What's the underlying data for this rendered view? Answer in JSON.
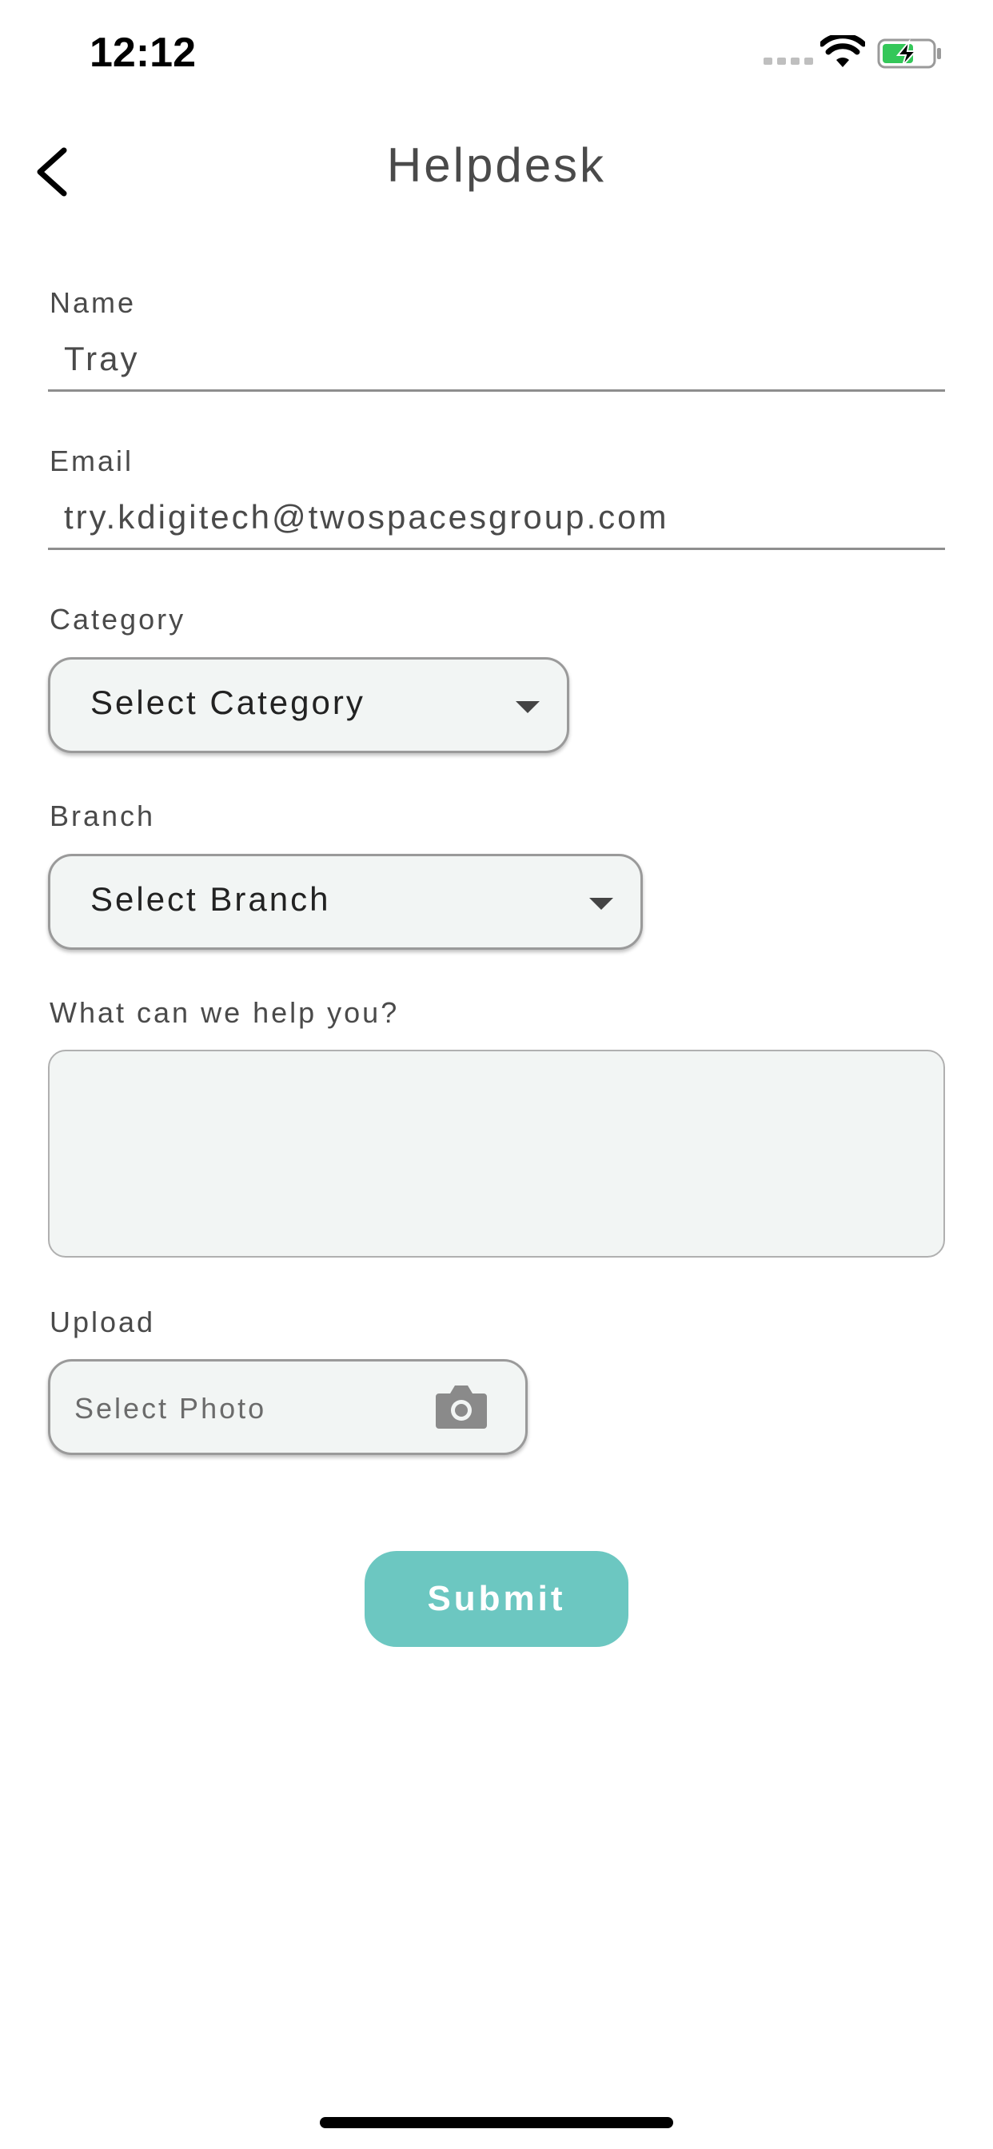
{
  "status_bar": {
    "time": "12:12"
  },
  "header": {
    "title": "Helpdesk"
  },
  "form": {
    "name": {
      "label": "Name",
      "value": "Tray"
    },
    "email": {
      "label": "Email",
      "value": "try.kdigitech@twospacesgroup.com"
    },
    "category": {
      "label": "Category",
      "selected": "Select Category"
    },
    "branch": {
      "label": "Branch",
      "selected": "Select Branch"
    },
    "help": {
      "label": "What can we help you?",
      "value": ""
    },
    "upload": {
      "label": "Upload",
      "placeholder": "Select Photo"
    },
    "submit_label": "Submit"
  },
  "icons": {
    "back": "chevron-left-icon",
    "camera": "camera-icon",
    "wifi": "wifi-icon",
    "battery": "battery-charging-icon"
  },
  "colors": {
    "accent": "#6cc7c1",
    "field_bg": "#f2f5f4",
    "battery_fill": "#34c759"
  }
}
